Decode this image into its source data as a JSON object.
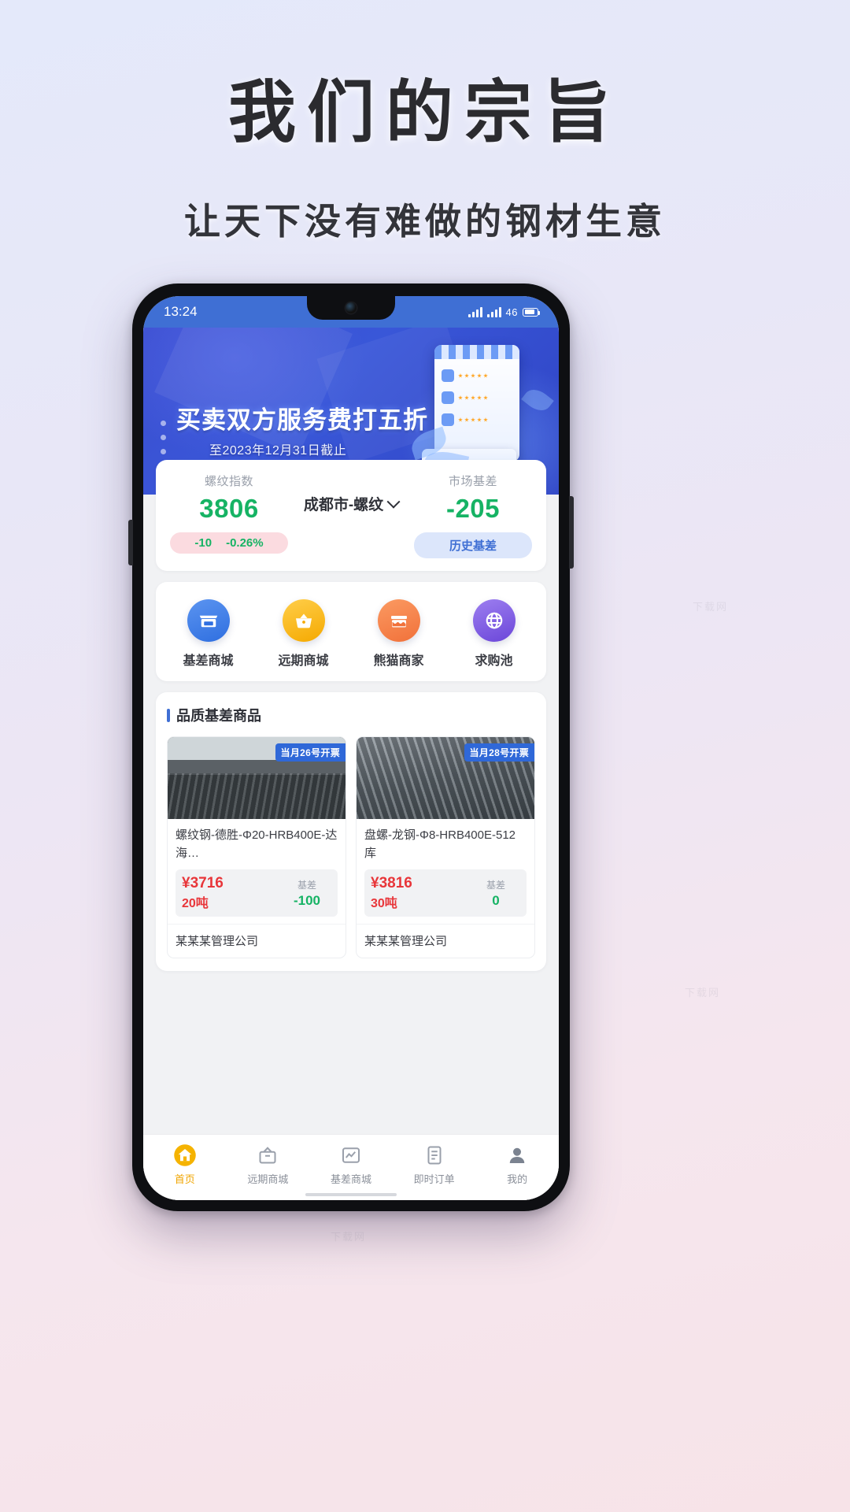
{
  "promo": {
    "title": "我们的宗旨",
    "subtitle": "让天下没有难做的钢材生意"
  },
  "statusbar": {
    "time": "13:24",
    "battery": "46"
  },
  "banner": {
    "title": "买卖双方服务费打五折",
    "subtitle": "至2023年12月31日截止",
    "dot_count": 5,
    "active_dot": 2
  },
  "index_card": {
    "left_label": "螺纹指数",
    "left_value": "3806",
    "change_abs": "-10",
    "change_pct": "-0.26%",
    "selector": "成都市-螺纹",
    "right_label": "市场基差",
    "right_value": "-205",
    "history_button": "历史基差"
  },
  "quick_nav": [
    {
      "label": "基差商城",
      "icon": "storefront-icon",
      "color": "#2f6fe0"
    },
    {
      "label": "远期商城",
      "icon": "basket-icon",
      "color": "#f5a900"
    },
    {
      "label": "熊猫商家",
      "icon": "shop-icon",
      "color": "#f1713a"
    },
    {
      "label": "求购池",
      "icon": "globe-icon",
      "color": "#6b46d9"
    }
  ],
  "products": {
    "section_title": "品质基差商品",
    "items": [
      {
        "badge": "当月26号开票",
        "name": "螺纹钢-德胜-Φ20-HRB400E-达海…",
        "price": "¥3716",
        "quantity": "20吨",
        "basis_label": "基差",
        "basis_value": "-100",
        "shop": "某某某管理公司"
      },
      {
        "badge": "当月28号开票",
        "name": "盘螺-龙钢-Φ8-HRB400E-512库",
        "price": "¥3816",
        "quantity": "30吨",
        "basis_label": "基差",
        "basis_value": "0",
        "shop": "某某某管理公司"
      }
    ]
  },
  "tabbar": [
    {
      "label": "首页",
      "icon": "home-icon",
      "active": true
    },
    {
      "label": "远期商城",
      "icon": "forward-mall-icon",
      "active": false
    },
    {
      "label": "基差商城",
      "icon": "basis-mall-icon",
      "active": false
    },
    {
      "label": "即时订单",
      "icon": "order-icon",
      "active": false
    },
    {
      "label": "我的",
      "icon": "user-icon",
      "active": false
    }
  ],
  "watermark": "下载网"
}
